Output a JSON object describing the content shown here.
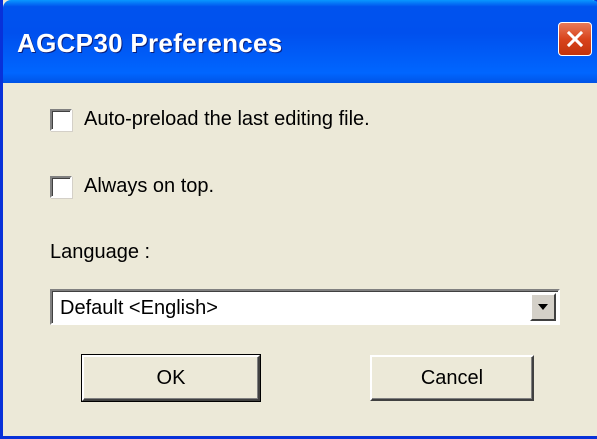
{
  "window": {
    "title": "AGCP30 Preferences",
    "close_icon": "close-icon"
  },
  "options": {
    "auto_preload": {
      "label": "Auto-preload the last editing file.",
      "checked": false
    },
    "always_on_top": {
      "label": "Always on top.",
      "checked": false
    }
  },
  "language": {
    "label": "Language :",
    "selected": "Default <English>",
    "dropdown_icon": "chevron-down-icon"
  },
  "buttons": {
    "ok_label": "OK",
    "cancel_label": "Cancel"
  },
  "colors": {
    "titlebar": "#0053ee",
    "close_button": "#d9441c",
    "dialog_background": "#ece9d8"
  }
}
